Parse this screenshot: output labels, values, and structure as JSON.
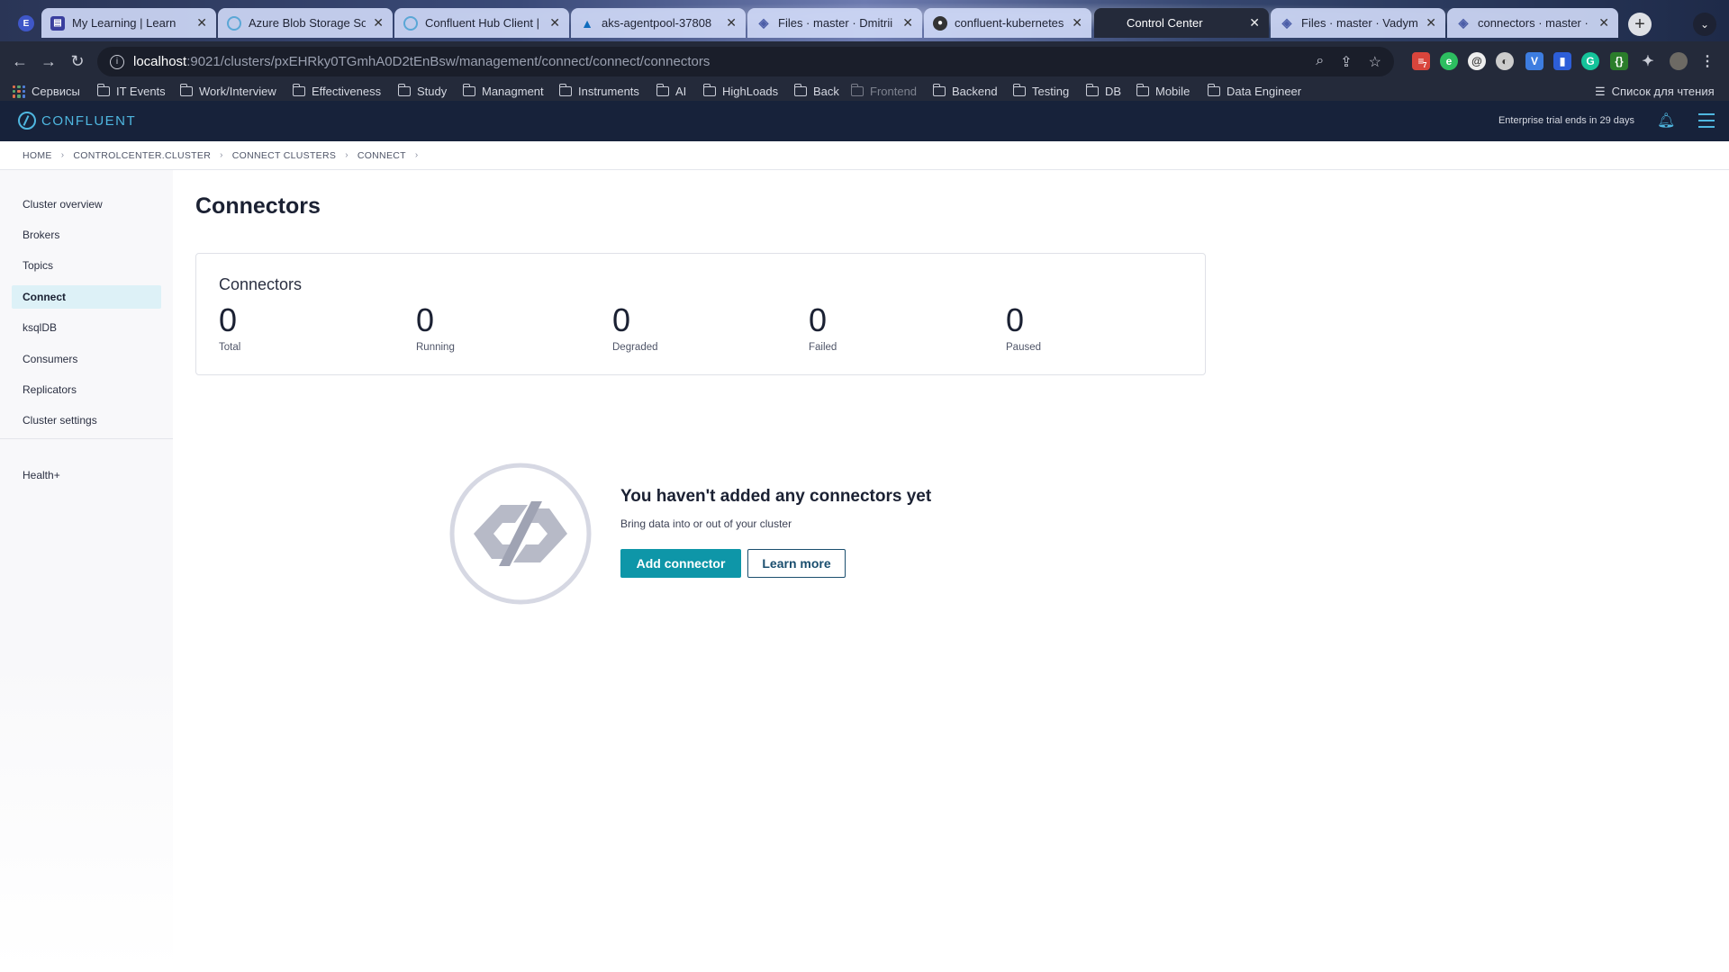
{
  "browser": {
    "profile_initial": "E",
    "tabs": [
      {
        "title": "My Learning | Learn",
        "icon": "learn-icon",
        "color": "#3a3f9e",
        "active": false
      },
      {
        "title": "Azure Blob Storage So",
        "icon": "confluent-icon",
        "color": "#5aa7d6",
        "active": false
      },
      {
        "title": "Confluent Hub Client |",
        "icon": "confluent-icon",
        "color": "#5aa7d6",
        "active": false
      },
      {
        "title": "aks-agentpool-37808",
        "icon": "azure-icon",
        "color": "#0f6cbd",
        "active": false
      },
      {
        "title": "Files · master · Dmitrii",
        "icon": "gitlab-icon",
        "color": "#4c5ea8",
        "active": false
      },
      {
        "title": "confluent-kubernetes-",
        "icon": "github-icon",
        "color": "#333333",
        "active": false
      },
      {
        "title": "Control Center",
        "icon": "",
        "color": "",
        "active": true
      },
      {
        "title": "Files · master · Vadym",
        "icon": "gitlab-icon",
        "color": "#4c5ea8",
        "active": false
      },
      {
        "title": "connectors · master ·",
        "icon": "gitlab-icon",
        "color": "#4c5ea8",
        "active": false
      }
    ],
    "url_host": "localhost",
    "url_rest": ":9021/clusters/pxEHRky0TGmhA0D2tEnBsw/management/connect/connect/connectors",
    "extension_badge": "7",
    "bookmarks": [
      "Сервисы",
      "IT Events",
      "Work/Interview",
      "Effectiveness",
      "Study",
      "Managment",
      "Instruments",
      "AI",
      "HighLoads",
      "Back",
      "Frontend",
      "Backend",
      "Testing",
      "DB",
      "Mobile",
      "Data Engineer"
    ],
    "reading_list": "Список для чтения"
  },
  "app": {
    "brand": "CONFLUENT",
    "trial_notice": "Enterprise trial ends in 29 days",
    "accent_color": "#0e96a8"
  },
  "breadcrumb": [
    "HOME",
    "CONTROLCENTER.CLUSTER",
    "CONNECT CLUSTERS",
    "CONNECT"
  ],
  "sidebar": {
    "items": [
      {
        "label": "Cluster overview",
        "active": false
      },
      {
        "label": "Brokers",
        "active": false
      },
      {
        "label": "Topics",
        "active": false
      },
      {
        "label": "Connect",
        "active": true
      },
      {
        "label": "ksqlDB",
        "active": false
      },
      {
        "label": "Consumers",
        "active": false
      },
      {
        "label": "Replicators",
        "active": false
      },
      {
        "label": "Cluster settings",
        "active": false
      }
    ],
    "footer_item": "Health+"
  },
  "main": {
    "title": "Connectors",
    "card": {
      "title": "Connectors",
      "stats": [
        {
          "value": "0",
          "label": "Total"
        },
        {
          "value": "0",
          "label": "Running"
        },
        {
          "value": "0",
          "label": "Degraded"
        },
        {
          "value": "0",
          "label": "Failed"
        },
        {
          "value": "0",
          "label": "Paused"
        }
      ]
    },
    "empty_state": {
      "title": "You haven't added any connectors yet",
      "subtitle": "Bring data into or out of your cluster",
      "primary_button": "Add connector",
      "secondary_button": "Learn more"
    }
  }
}
